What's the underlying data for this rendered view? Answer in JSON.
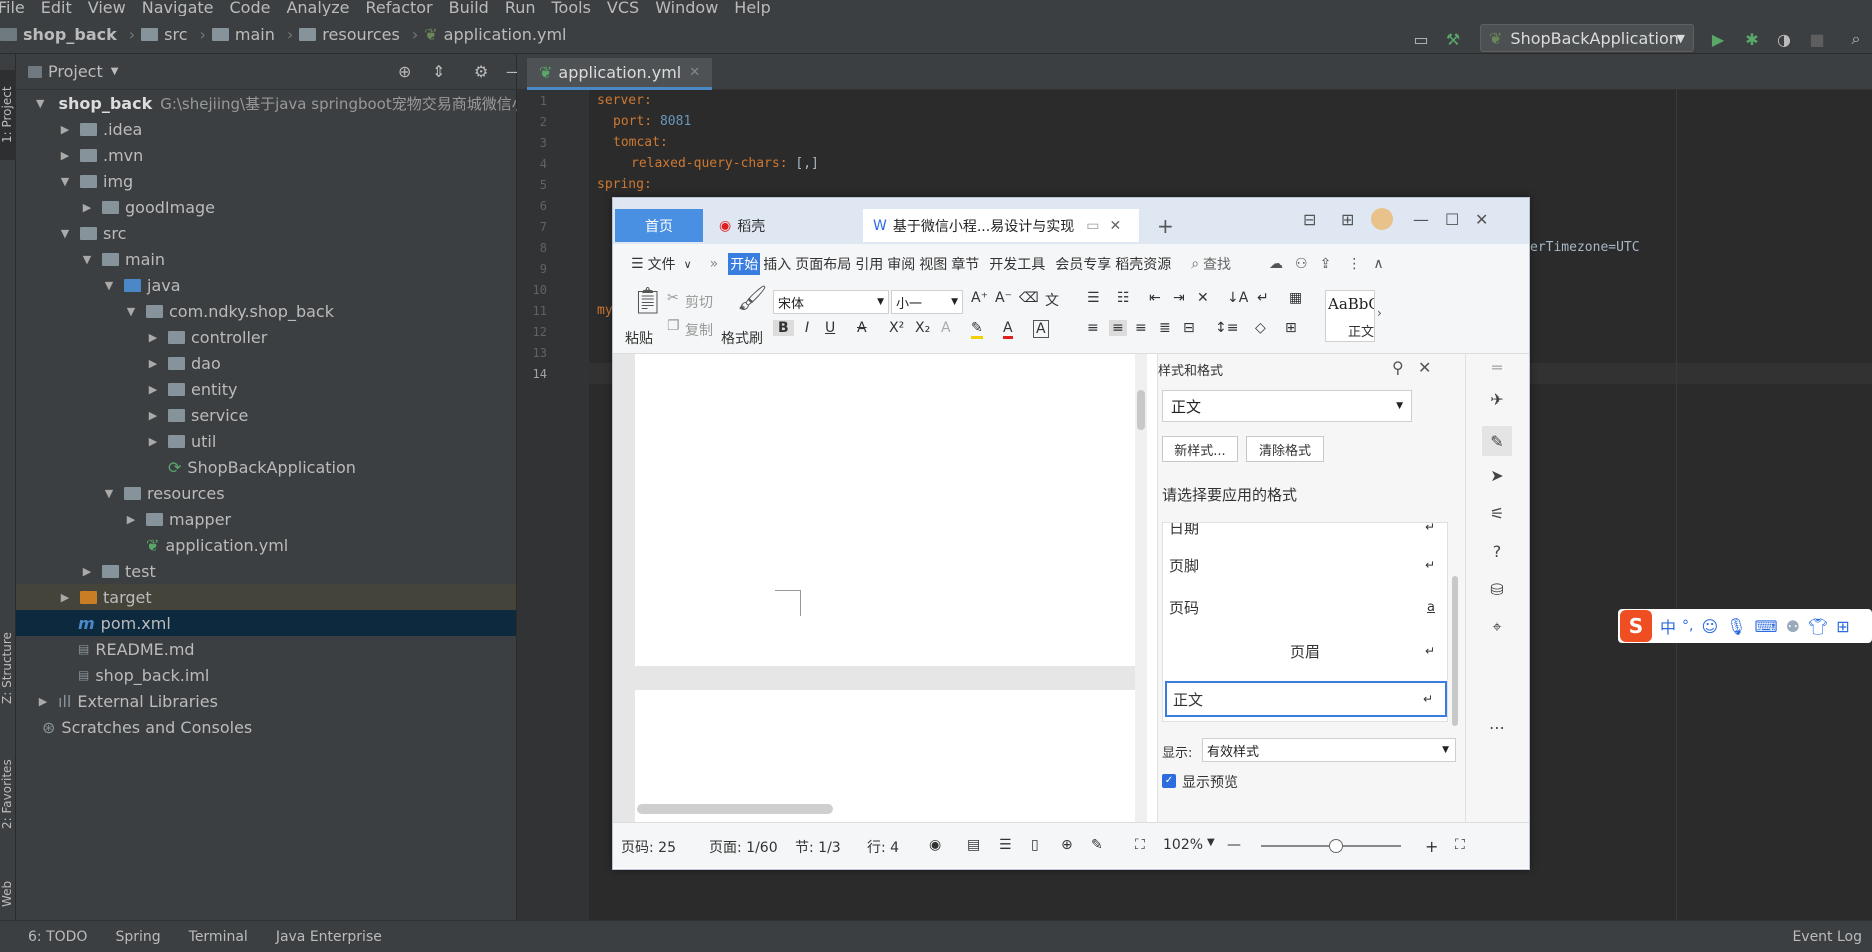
{
  "menubar": [
    "File",
    "Edit",
    "View",
    "Navigate",
    "Code",
    "Analyze",
    "Refactor",
    "Build",
    "Run",
    "Tools",
    "VCS",
    "Window",
    "Help"
  ],
  "breadcrumb": [
    "shop_back",
    "src",
    "main",
    "resources",
    "application.yml"
  ],
  "run_config": "ShopBackApplication",
  "project_panel": {
    "title": "Project",
    "root": "shop_back",
    "root_path": "G:\\shejiing\\基于java springboot宠物交易商城微信小",
    "items": [
      ".idea",
      ".mvn",
      "img",
      "goodImage",
      "src",
      "main",
      "java",
      "com.ndky.shop_back",
      "controller",
      "dao",
      "entity",
      "service",
      "util",
      "ShopBackApplication",
      "resources",
      "mapper",
      "application.yml",
      "test",
      "target",
      "pom.xml",
      "README.md",
      "shop_back.iml",
      "External Libraries",
      "Scratches and Consoles"
    ]
  },
  "side_labels": {
    "project": "1: Project",
    "structure": "Z: Structure",
    "favorites": "2: Favorites",
    "web": "Web"
  },
  "editor": {
    "tab": "application.yml",
    "line_numbers": [
      "1",
      "2",
      "3",
      "4",
      "5",
      "6",
      "7",
      "8",
      "9",
      "10",
      "11",
      "12",
      "13",
      "14"
    ],
    "lines": {
      "l1": "server:",
      "l2_key": "port:",
      "l2_val": "8081",
      "l3": "tomcat:",
      "l4_key": "relaxed-query-chars:",
      "l4_val": "[,]",
      "l5": "spring:",
      "l11": "my",
      "tail": "erTimezone=UTC"
    }
  },
  "statusbar": {
    "todo": "6: TODO",
    "spring": "Spring",
    "terminal": "Terminal",
    "java_ee": "Java Enterprise",
    "event_log": "Event Log"
  },
  "wps": {
    "tab_home": "首页",
    "tab_daoke": "稻壳",
    "tab_doc": "基于微信小程...易设计与实现",
    "menu": {
      "file": "文件",
      "start": "开始",
      "insert": "插入",
      "layout": "页面布局",
      "ref": "引用",
      "review": "审阅",
      "view": "视图",
      "chapter": "章节",
      "dev": "开发工具",
      "member": "会员专享",
      "shell": "稻壳资源",
      "search": "查找"
    },
    "ribbon": {
      "paste": "粘贴",
      "cut": "剪切",
      "copy": "复制",
      "painter": "格式刷",
      "font": "宋体",
      "size": "小一",
      "style_preview": "AaBbC",
      "style_name": "正文"
    },
    "pane": {
      "title": "样式和格式",
      "current": "正文",
      "new_style": "新样式...",
      "clear": "清除格式",
      "choose": "请选择要应用的格式",
      "styles": [
        "日期",
        "页脚",
        "页码",
        "页眉",
        "正文"
      ],
      "show_label": "显示:",
      "show_value": "有效样式",
      "preview": "显示预览"
    },
    "status": {
      "page_code": "页码: 25",
      "page": "页面: 1/60",
      "section": "节: 1/3",
      "line": "行: 4",
      "zoom": "102%"
    }
  },
  "ime": {
    "cn": "中",
    "punct": "°,"
  }
}
